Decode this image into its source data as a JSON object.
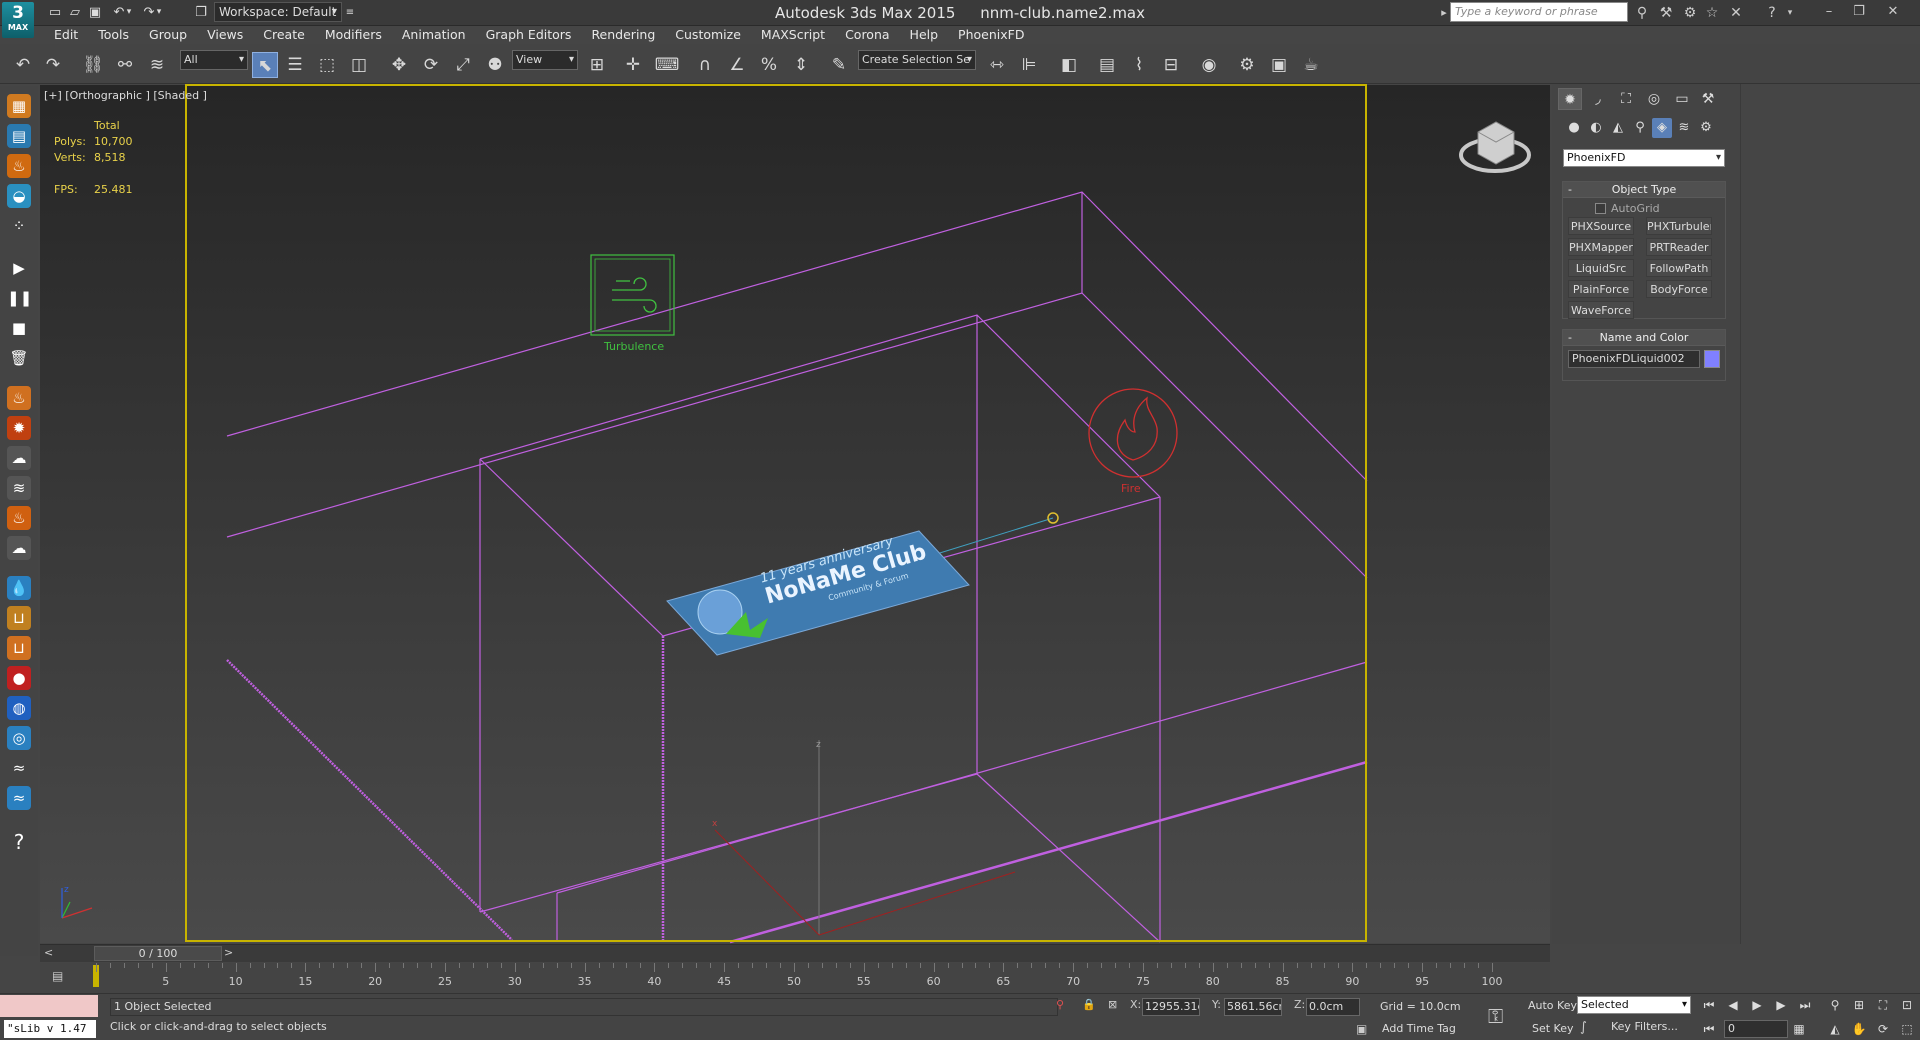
{
  "window": {
    "app_name": "Autodesk 3ds Max  2015",
    "file_name": "nnm-club.name2.max",
    "logo_text": "3",
    "logo_sub": "MAX",
    "workspace": "Workspace: Default",
    "search_placeholder": "Type a keyword or phrase"
  },
  "menu": [
    "Edit",
    "Tools",
    "Group",
    "Views",
    "Create",
    "Modifiers",
    "Animation",
    "Graph Editors",
    "Rendering",
    "Customize",
    "MAXScript",
    "Corona",
    "Help",
    "PhoenixFD"
  ],
  "toolbar": {
    "selection_filter": "All",
    "ref_coord": "View",
    "named_selection": "Create Selection Se"
  },
  "viewport": {
    "label": "[+] [Orthographic ] [Shaded ]",
    "stats_header": "Total",
    "polys_label": "Polys:",
    "polys": "10,700",
    "verts_label": "Verts:",
    "verts": "8,518",
    "fps_label": "FPS:",
    "fps": "25.481",
    "helper_turbulence": "Turbulence",
    "helper_fire": "Fire",
    "logo_line1": "11 years anniversary",
    "logo_line2": "NoNaMe Club",
    "logo_line3": "Community & Forum",
    "axis_x": "x",
    "axis_y": "y",
    "axis_z": "z"
  },
  "command_panel": {
    "category": "PhoenixFD",
    "object_type_title": "Object Type",
    "autogrid_label": "AutoGrid",
    "buttons": [
      "PHXSource",
      "PHXTurbulence",
      "PHXMapper",
      "PRTReader",
      "LiquidSrc",
      "FollowPath",
      "PlainForce",
      "BodyForce",
      "WaveForce"
    ],
    "name_color_title": "Name and Color",
    "object_name": "PhoenixFDLiquid002",
    "object_color": "#8080ff"
  },
  "timeline": {
    "slider": "0 / 100",
    "ticks": [
      "5",
      "10",
      "15",
      "20",
      "25",
      "30",
      "35",
      "40",
      "45",
      "50",
      "55",
      "60",
      "65",
      "70",
      "75",
      "80",
      "85",
      "90",
      "95",
      "100"
    ]
  },
  "status": {
    "script_label": "\"sLib v 1.47",
    "selection": "1 Object Selected",
    "prompt": "Click or click-and-drag to select objects",
    "x_label": "X:",
    "x_value": "12955.31cr",
    "y_label": "Y:",
    "y_value": "5861.56cm",
    "z_label": "Z:",
    "z_value": "0.0cm",
    "grid": "Grid = 10.0cm",
    "add_time_tag": "Add Time Tag",
    "auto_key": "Auto Key",
    "set_key": "Set Key",
    "key_mode": "Selected",
    "key_filters": "Key Filters...",
    "frame": "0"
  },
  "colors": {
    "accent": "#5a80b8",
    "viewport_border": "#c8b400",
    "wireframe": "#c060e0",
    "turbulence": "#40c040",
    "fire": "#d03030"
  }
}
